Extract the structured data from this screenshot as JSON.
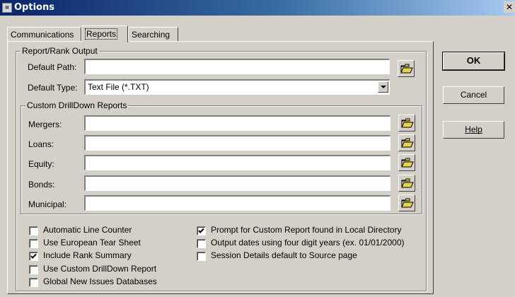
{
  "window": {
    "title": "Options",
    "close_glyph": "✕",
    "icon": "app-icon",
    "title_gradient": [
      "#0a246a",
      "#a6caf0"
    ]
  },
  "tabs": [
    {
      "label": "Communications",
      "active": false
    },
    {
      "label": "Reports",
      "active": true
    },
    {
      "label": "Searching",
      "active": false
    }
  ],
  "report_output": {
    "group_label": "Report/Rank Output",
    "default_path_label": "Default Path:",
    "default_path_value": "",
    "default_type_label": "Default Type:",
    "default_type_value": "Text File (*.TXT)"
  },
  "drilldown": {
    "group_label": "Custom DrillDown Reports",
    "fields": [
      {
        "label": "Mergers:",
        "value": ""
      },
      {
        "label": "Loans:",
        "value": ""
      },
      {
        "label": "Equity:",
        "value": ""
      },
      {
        "label": "Bonds:",
        "value": ""
      },
      {
        "label": "Municipal:",
        "value": ""
      }
    ]
  },
  "checkboxes_left": [
    {
      "label": "Automatic Line Counter",
      "checked": false
    },
    {
      "label": "Use European Tear Sheet",
      "checked": false
    },
    {
      "label": "Include Rank Summary",
      "checked": true
    },
    {
      "label": "Use Custom DrillDown Report",
      "checked": false
    },
    {
      "label": "Global New Issues Databases",
      "checked": false
    }
  ],
  "checkboxes_right": [
    {
      "label": "Prompt for Custom Report found in Local Directory",
      "checked": true
    },
    {
      "label": "Output dates using four digit years (ex. 01/01/2000)",
      "checked": false
    },
    {
      "label": "Session Details default to Source page",
      "checked": false
    }
  ],
  "buttons": {
    "ok": "OK",
    "cancel": "Cancel",
    "help": "Help"
  },
  "colors": {
    "face": "#d4d0c8",
    "folder_icon": "#e8d44c"
  }
}
